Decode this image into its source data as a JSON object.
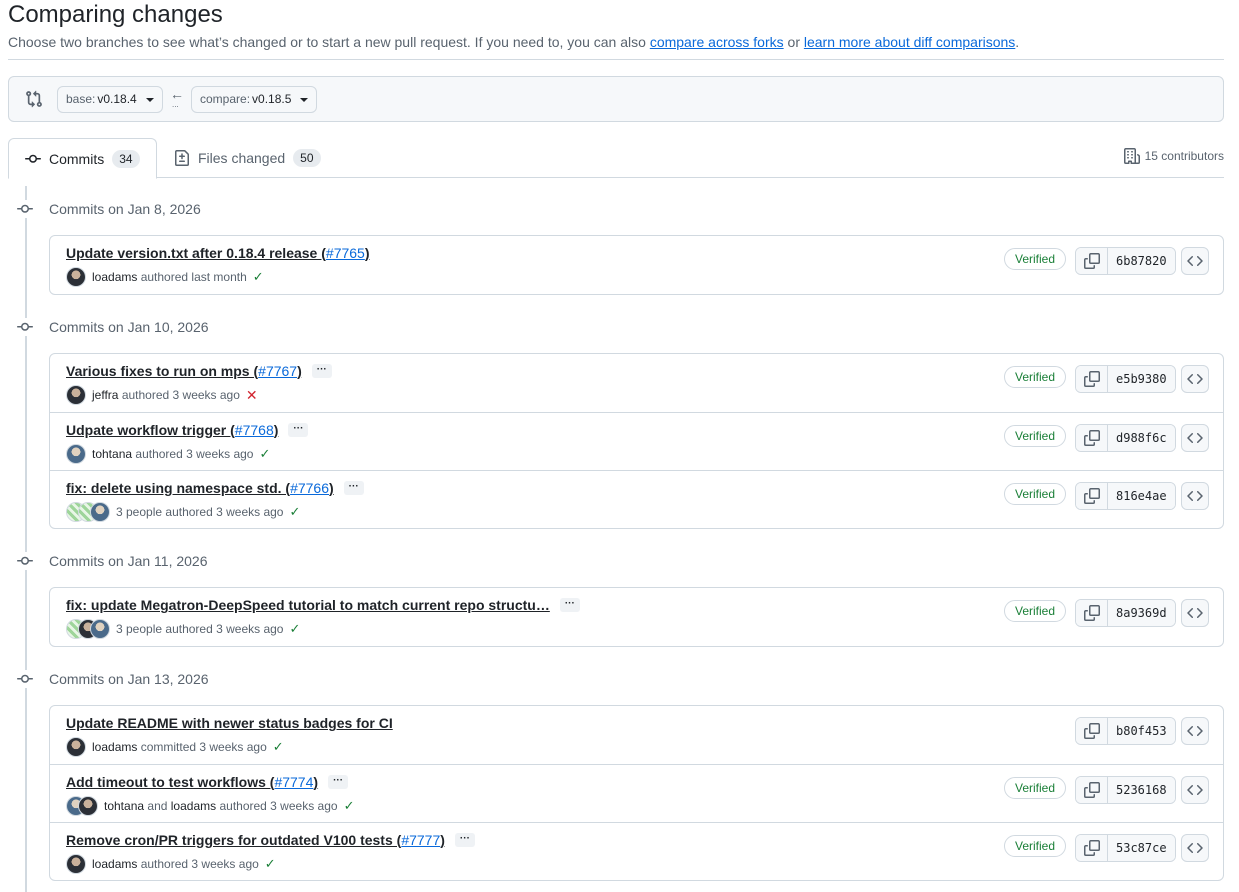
{
  "header": {
    "title": "Comparing changes",
    "subtitle_pre": "Choose two branches to see what’s changed or to start a new pull request. If you need to, you can also",
    "link_forks": "compare across forks",
    "subtitle_or": "or",
    "link_learn": "learn more about diff comparisons",
    "subtitle_end": "."
  },
  "range": {
    "base_prefix": "base:",
    "base_value": "v0.18.4",
    "compare_prefix": "compare:",
    "compare_value": "v0.18.5"
  },
  "tabs": {
    "commits_label": "Commits",
    "commits_count": "34",
    "files_label": "Files changed",
    "files_count": "50",
    "contributors": "15 contributors"
  },
  "groups": [
    {
      "date_label": "Commits on Jan 8, 2026",
      "commits": [
        {
          "title": "Update version.txt after 0.18.4 release (",
          "pr": "#7765",
          "close": ")",
          "author": "loadams",
          "action": "authored last month",
          "verified": "Verified",
          "sha": "6b87820",
          "status": "success"
        }
      ]
    },
    {
      "date_label": "Commits on Jan 10, 2026",
      "commits": [
        {
          "title": "Various fixes to run on mps (",
          "pr": "#7767",
          "close": ")",
          "author": "jeffra",
          "action": "authored 3 weeks ago",
          "verified": "Verified",
          "sha": "e5b9380",
          "status": "failure"
        },
        {
          "title": "Udpate workflow trigger (",
          "pr": "#7768",
          "close": ")",
          "author": "tohtana",
          "action": "authored 3 weeks ago",
          "verified": "Verified",
          "sha": "d988f6c",
          "status": "success"
        },
        {
          "title": "fix: delete using namespace std. (",
          "pr": "#7766",
          "close": ")",
          "author": "3 people",
          "action": "authored 3 weeks ago",
          "verified": "Verified",
          "sha": "816e4ae",
          "status": "success"
        }
      ]
    },
    {
      "date_label": "Commits on Jan 11, 2026",
      "commits": [
        {
          "title": "fix: update Megatron-DeepSpeed tutorial to match current repo structu…",
          "author": "3 people",
          "action": "authored 3 weeks ago",
          "verified": "Verified",
          "sha": "8a9369d",
          "status": "success"
        }
      ]
    },
    {
      "date_label": "Commits on Jan 13, 2026",
      "commits": [
        {
          "title": "Update README with newer status badges for CI",
          "author": "loadams",
          "action": "committed 3 weeks ago",
          "sha": "b80f453",
          "status": "success"
        },
        {
          "title": "Add timeout to test workflows (",
          "pr": "#7774",
          "close": ")",
          "author": "tohtana",
          "joiner": "and",
          "author2": "loadams",
          "action": "authored 3 weeks ago",
          "verified": "Verified",
          "sha": "5236168",
          "status": "success"
        },
        {
          "title": "Remove cron/PR triggers for outdated V100 tests (",
          "pr": "#7777",
          "close": ")",
          "author": "loadams",
          "action": "authored 3 weeks ago",
          "verified": "Verified",
          "sha": "53c87ce",
          "status": "success"
        }
      ]
    }
  ]
}
